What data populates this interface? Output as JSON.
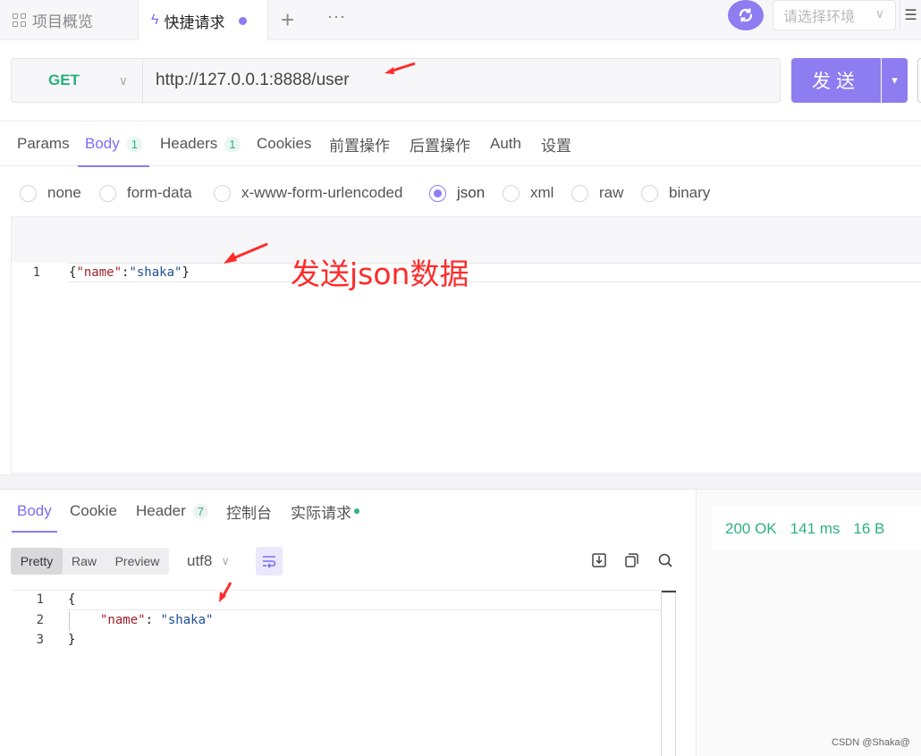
{
  "tabs": {
    "overview": "项目概览",
    "quick": "快捷请求",
    "add": "+",
    "more": "···"
  },
  "env": {
    "placeholder": "请选择环境"
  },
  "request": {
    "method": "GET",
    "url": "http://127.0.0.1:8888/user",
    "send_label": "发送"
  },
  "request_tabs": [
    {
      "label": "Params"
    },
    {
      "label": "Body",
      "badge": "1"
    },
    {
      "label": "Headers",
      "badge": "1"
    },
    {
      "label": "Cookies"
    },
    {
      "label": "前置操作"
    },
    {
      "label": "后置操作"
    },
    {
      "label": "Auth"
    },
    {
      "label": "设置"
    }
  ],
  "body_types": [
    "none",
    "form-data",
    "x-www-form-urlencoded",
    "json",
    "xml",
    "raw",
    "binary"
  ],
  "body_type_selected": "json",
  "request_body": {
    "line_no": "1",
    "p1": "{",
    "k1": "\"name\"",
    "colon": ":",
    "v1": "\"shaka\"",
    "p2": "}"
  },
  "annotation": "发送json数据",
  "response_tabs": [
    {
      "label": "Body"
    },
    {
      "label": "Cookie"
    },
    {
      "label": "Header",
      "badge": "7"
    },
    {
      "label": "控制台"
    },
    {
      "label": "实际请求"
    }
  ],
  "view_modes": [
    "Pretty",
    "Raw",
    "Preview"
  ],
  "encoding": "utf8",
  "response_body": {
    "ln1": "1",
    "ln2": "2",
    "ln3": "3",
    "open": "{",
    "key": "\"name\"",
    "sep": ": ",
    "value": "\"shaka\"",
    "close": "}"
  },
  "status": {
    "code": "200 OK",
    "time": "141 ms",
    "size": "16 B"
  },
  "watermark": "CSDN @Shaka@",
  "colors": {
    "accent": "#8e7cf1",
    "method_green": "#26b07e",
    "status_green": "#2eb27f",
    "annotation_red": "#ff2b2b"
  }
}
